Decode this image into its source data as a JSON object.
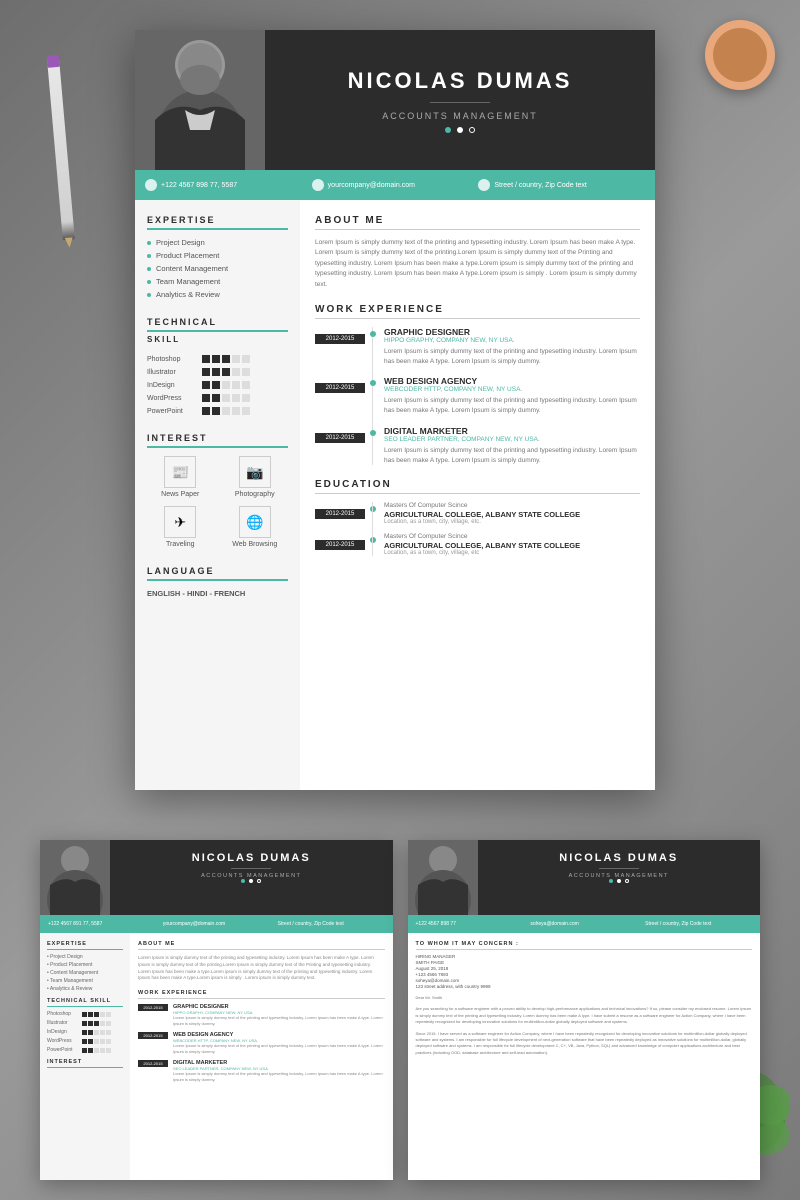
{
  "page": {
    "background_color": "#8a8a8a"
  },
  "resume": {
    "header": {
      "name": "NICOLAS DUMAS",
      "title": "ACCOUNTS MANAGEMENT"
    },
    "contact": {
      "phone": "+122 4567 898 77, 5587",
      "email": "yourcompany@domain.com",
      "address": "Street / country, Zip Code text"
    },
    "sidebar": {
      "expertise_title": "EXPERTISE",
      "expertise_items": [
        "Project Design",
        "Product Placement",
        "Content Management",
        "Team Management",
        "Analytics & Review"
      ],
      "technical_title": "TECHNICAL SKILL",
      "skills": [
        {
          "name": "Photoshop",
          "filled": 3,
          "empty": 2
        },
        {
          "name": "Illustrator",
          "filled": 3,
          "empty": 2
        },
        {
          "name": "InDesign",
          "filled": 2,
          "empty": 3
        },
        {
          "name": "WordPress",
          "filled": 2,
          "empty": 3
        },
        {
          "name": "PowerPoint",
          "filled": 2,
          "empty": 3
        }
      ],
      "interest_title": "INTEREST",
      "interests": [
        {
          "name": "News Paper",
          "icon": "📰"
        },
        {
          "name": "Photography",
          "icon": "📷"
        },
        {
          "name": "Traveling",
          "icon": "✈"
        },
        {
          "name": "Web Browsing",
          "icon": "🌐"
        }
      ],
      "language_title": "LANGUAGE",
      "languages": "ENGLISH - HINDI - FRENCH"
    },
    "main": {
      "about_title": "ABOUT ME",
      "about_text": "Lorem Ipsum is simply dummy text of the printing and typesetting industry. Lorem Ipsum has been make A type. Lorem Ipsum is simply dummy text of the printing.Lorem Ipsum is simply dummy text of the Printing and typesetting industry. Lorem Ipsum has been make a type.Lorem ipsum is simply dummy text of the printing and typesetting industry. Lorem Ipsum has been make A type.Lorem ipsum is simply . Lorem ipsum is simply dummy text.",
      "work_title": "WORK EXPERIENCE",
      "jobs": [
        {
          "years": "2012-2015",
          "title": "GRAPHIC DESIGNER",
          "company": "HIPPO GRAPHY, COMPANY NEW, NY USA.",
          "desc": "Lorem Ipsum is simply dummy text of the printing and typesetting industry. Lorem Ipsum has been make A type. Lorem Ipsum is simply dummy."
        },
        {
          "years": "2012-2015",
          "title": "WEB DESIGN AGENCY",
          "company": "WEBCODER HTTP, COMPANY NEW, NY USA.",
          "desc": "Lorem Ipsum is simply dummy text of the printing and typesetting industry. Lorem Ipsum has been make A type. Lorem Ipsum is simply dummy."
        },
        {
          "years": "2012-2015",
          "title": "DIGITAL MARKETER",
          "company": "SEO LEADER PARTNER, COMPANY NEW, NY USA.",
          "desc": "Lorem Ipsum is simply dummy text of the printing and typesetting industry. Lorem Ipsum has been make A type. Lorem Ipsum is simply dummy."
        }
      ],
      "education_title": "EDUCATION",
      "education": [
        {
          "years": "2012-2015",
          "degree": "Masters Of Computer Scince",
          "school": "AGRICULTURAL COLLEGE, ALBANY STATE COLLEGE",
          "location": "Location, as a town, city, village, etc."
        },
        {
          "years": "2012-2015",
          "degree": "Masters Of Computer Scince",
          "school": "AGRICULTURAL COLLEGE, ALBANY STATE COLLEGE",
          "location": "Location, as a town, city, village, etc"
        }
      ]
    }
  },
  "letter": {
    "to_title": "TO WHOM IT MAY CONCERN :",
    "hiring_manager": "HIRING MANAGER",
    "name": "SMITH PAIGE",
    "date": "August 25, 2018",
    "phone": "+123 4566 7893",
    "email": "soheya@domain.com",
    "address": "123 street address, with country 9999",
    "greeting": "Dear Mr. Smith",
    "body1": "Are you searching for a software engineer with a proven ability to develop high-performance applications and technical innovations? If so, please consider my enclosed resume. Lorem Ipsum is simply dummy text of the printing and typesetting industry. Lorem dummy has been make A type. I have submit a resume as a software engineer for Action Company, where I have been repeatedly recognized for developing innovative solutions for multimillion-dollar globally deployed software and systems.",
    "body2": "Since 2015, I have served as a software engineer for Action Company, where I have been repeatedly recognized for developing innovative solutions for multimillion-dollar globally deployed software and systems. I am responsible for full lifecycle development of next-generation software that have been repeatedly deployed as innovative solutions for multimillion-dollar, globally deployed software and systems. I am responsible for full lifecycle development C, C+, VB, Java, Python, SQL) and advanced knowledge of computer applications architecture and best practices (including OOD, database architecture and self-lead automation)."
  },
  "ui": {
    "teal_color": "#4db8a4",
    "dark_color": "#2c2c2c",
    "light_gray": "#f5f5f5"
  }
}
